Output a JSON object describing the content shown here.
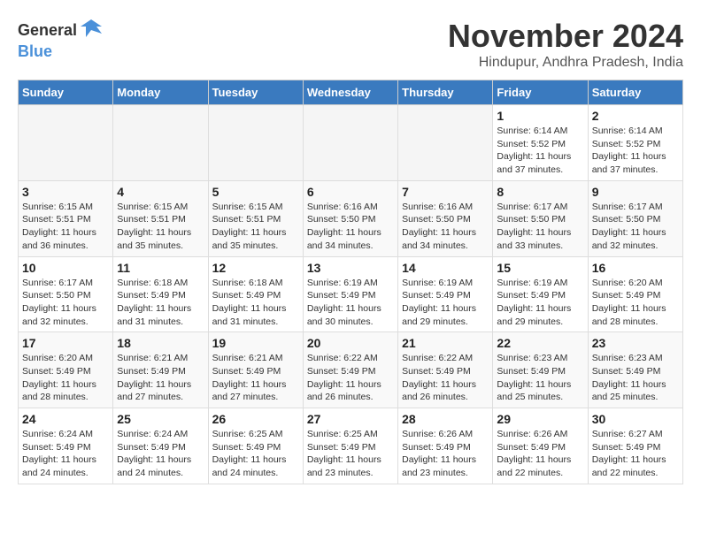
{
  "header": {
    "logo_general": "General",
    "logo_blue": "Blue",
    "month_title": "November 2024",
    "location": "Hindupur, Andhra Pradesh, India"
  },
  "days_of_week": [
    "Sunday",
    "Monday",
    "Tuesday",
    "Wednesday",
    "Thursday",
    "Friday",
    "Saturday"
  ],
  "weeks": [
    [
      {
        "day": "",
        "info": ""
      },
      {
        "day": "",
        "info": ""
      },
      {
        "day": "",
        "info": ""
      },
      {
        "day": "",
        "info": ""
      },
      {
        "day": "",
        "info": ""
      },
      {
        "day": "1",
        "info": "Sunrise: 6:14 AM\nSunset: 5:52 PM\nDaylight: 11 hours\nand 37 minutes."
      },
      {
        "day": "2",
        "info": "Sunrise: 6:14 AM\nSunset: 5:52 PM\nDaylight: 11 hours\nand 37 minutes."
      }
    ],
    [
      {
        "day": "3",
        "info": "Sunrise: 6:15 AM\nSunset: 5:51 PM\nDaylight: 11 hours\nand 36 minutes."
      },
      {
        "day": "4",
        "info": "Sunrise: 6:15 AM\nSunset: 5:51 PM\nDaylight: 11 hours\nand 35 minutes."
      },
      {
        "day": "5",
        "info": "Sunrise: 6:15 AM\nSunset: 5:51 PM\nDaylight: 11 hours\nand 35 minutes."
      },
      {
        "day": "6",
        "info": "Sunrise: 6:16 AM\nSunset: 5:50 PM\nDaylight: 11 hours\nand 34 minutes."
      },
      {
        "day": "7",
        "info": "Sunrise: 6:16 AM\nSunset: 5:50 PM\nDaylight: 11 hours\nand 34 minutes."
      },
      {
        "day": "8",
        "info": "Sunrise: 6:17 AM\nSunset: 5:50 PM\nDaylight: 11 hours\nand 33 minutes."
      },
      {
        "day": "9",
        "info": "Sunrise: 6:17 AM\nSunset: 5:50 PM\nDaylight: 11 hours\nand 32 minutes."
      }
    ],
    [
      {
        "day": "10",
        "info": "Sunrise: 6:17 AM\nSunset: 5:50 PM\nDaylight: 11 hours\nand 32 minutes."
      },
      {
        "day": "11",
        "info": "Sunrise: 6:18 AM\nSunset: 5:49 PM\nDaylight: 11 hours\nand 31 minutes."
      },
      {
        "day": "12",
        "info": "Sunrise: 6:18 AM\nSunset: 5:49 PM\nDaylight: 11 hours\nand 31 minutes."
      },
      {
        "day": "13",
        "info": "Sunrise: 6:19 AM\nSunset: 5:49 PM\nDaylight: 11 hours\nand 30 minutes."
      },
      {
        "day": "14",
        "info": "Sunrise: 6:19 AM\nSunset: 5:49 PM\nDaylight: 11 hours\nand 29 minutes."
      },
      {
        "day": "15",
        "info": "Sunrise: 6:19 AM\nSunset: 5:49 PM\nDaylight: 11 hours\nand 29 minutes."
      },
      {
        "day": "16",
        "info": "Sunrise: 6:20 AM\nSunset: 5:49 PM\nDaylight: 11 hours\nand 28 minutes."
      }
    ],
    [
      {
        "day": "17",
        "info": "Sunrise: 6:20 AM\nSunset: 5:49 PM\nDaylight: 11 hours\nand 28 minutes."
      },
      {
        "day": "18",
        "info": "Sunrise: 6:21 AM\nSunset: 5:49 PM\nDaylight: 11 hours\nand 27 minutes."
      },
      {
        "day": "19",
        "info": "Sunrise: 6:21 AM\nSunset: 5:49 PM\nDaylight: 11 hours\nand 27 minutes."
      },
      {
        "day": "20",
        "info": "Sunrise: 6:22 AM\nSunset: 5:49 PM\nDaylight: 11 hours\nand 26 minutes."
      },
      {
        "day": "21",
        "info": "Sunrise: 6:22 AM\nSunset: 5:49 PM\nDaylight: 11 hours\nand 26 minutes."
      },
      {
        "day": "22",
        "info": "Sunrise: 6:23 AM\nSunset: 5:49 PM\nDaylight: 11 hours\nand 25 minutes."
      },
      {
        "day": "23",
        "info": "Sunrise: 6:23 AM\nSunset: 5:49 PM\nDaylight: 11 hours\nand 25 minutes."
      }
    ],
    [
      {
        "day": "24",
        "info": "Sunrise: 6:24 AM\nSunset: 5:49 PM\nDaylight: 11 hours\nand 24 minutes."
      },
      {
        "day": "25",
        "info": "Sunrise: 6:24 AM\nSunset: 5:49 PM\nDaylight: 11 hours\nand 24 minutes."
      },
      {
        "day": "26",
        "info": "Sunrise: 6:25 AM\nSunset: 5:49 PM\nDaylight: 11 hours\nand 24 minutes."
      },
      {
        "day": "27",
        "info": "Sunrise: 6:25 AM\nSunset: 5:49 PM\nDaylight: 11 hours\nand 23 minutes."
      },
      {
        "day": "28",
        "info": "Sunrise: 6:26 AM\nSunset: 5:49 PM\nDaylight: 11 hours\nand 23 minutes."
      },
      {
        "day": "29",
        "info": "Sunrise: 6:26 AM\nSunset: 5:49 PM\nDaylight: 11 hours\nand 22 minutes."
      },
      {
        "day": "30",
        "info": "Sunrise: 6:27 AM\nSunset: 5:49 PM\nDaylight: 11 hours\nand 22 minutes."
      }
    ]
  ]
}
